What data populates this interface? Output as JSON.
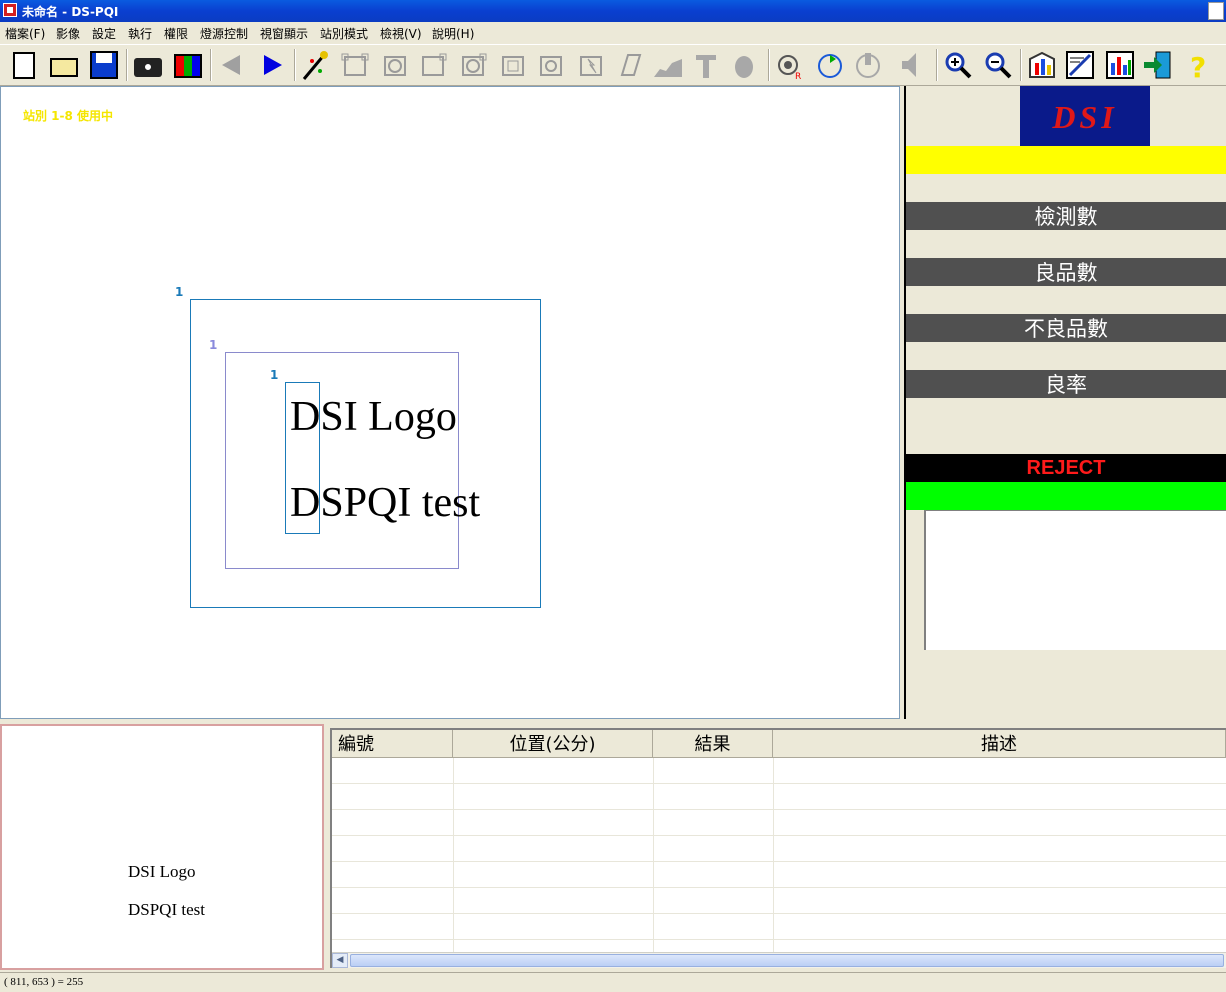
{
  "window": {
    "title": "未命名 - DS-PQI"
  },
  "menu": [
    {
      "label": "檔案(F)"
    },
    {
      "label": "影像"
    },
    {
      "label": "設定"
    },
    {
      "label": "執行"
    },
    {
      "label": "權限"
    },
    {
      "label": "燈源控制"
    },
    {
      "label": "視窗顯示"
    },
    {
      "label": "站別模式"
    },
    {
      "label": "檢視(V)"
    },
    {
      "label": "說明(H)"
    }
  ],
  "toolbar": {
    "icons": [
      "new-file-icon",
      "open-folder-icon",
      "save-disk-icon",
      "camera-icon",
      "color-bars-icon",
      "prev-arrow-icon",
      "next-arrow-icon",
      "wand-icon",
      "roi-tool-1-icon",
      "roi-tool-2-icon",
      "roi-tool-3-icon",
      "roi-tool-4-icon",
      "roi-tool-5-icon",
      "roi-tool-6-icon",
      "roi-tool-7-icon",
      "roi-tool-8-icon",
      "chart-tool-icon",
      "gauge-tool-icon",
      "hand-tool-icon",
      "record-icon",
      "run-cycle-icon",
      "stop-icon",
      "sound-icon",
      "zoom-in-icon",
      "zoom-out-icon",
      "report-icon",
      "document-icon",
      "bar-chart-icon",
      "exit-icon",
      "help-icon"
    ]
  },
  "canvas": {
    "station_status": "站別 1-8 使用中",
    "roi_labels": [
      "1",
      "1",
      "1"
    ],
    "text_line_1": "DSI Logo",
    "text_line_2": "DSPQI test"
  },
  "right_panel": {
    "logo": "DSI",
    "stats": [
      {
        "label": "檢測數"
      },
      {
        "label": "良品數"
      },
      {
        "label": "不良品數"
      },
      {
        "label": "良率"
      }
    ],
    "result": "REJECT",
    "colors": {
      "highlight": "#ffff00",
      "reject_text": "#ff1a1a",
      "pass_bar": "#00ff00",
      "logo_bg": "#0a1a8a",
      "logo_text": "#e01818"
    }
  },
  "preview": {
    "line_1": "DSI Logo",
    "line_2": "DSPQI test"
  },
  "table": {
    "columns": [
      "編號",
      "位置(公分)",
      "結果",
      "描述"
    ],
    "rows": []
  },
  "status_bar": {
    "pixel_readout": "( 811, 653 ) = 255"
  }
}
